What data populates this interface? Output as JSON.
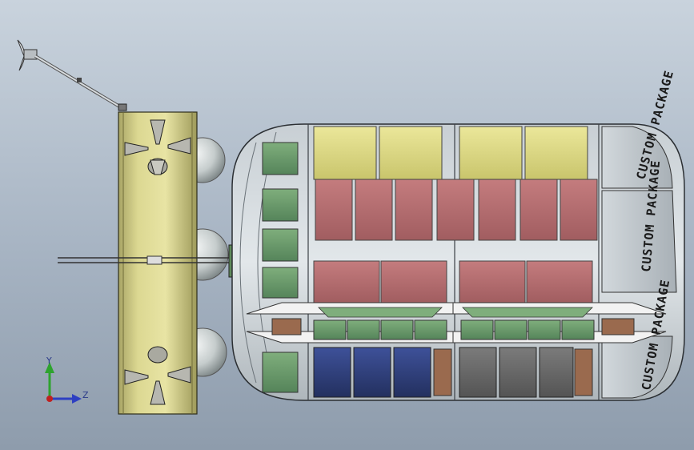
{
  "pod_labels": {
    "top": "CUSTOM PACKAGE",
    "middle": "CUSTOM PACKAGE",
    "bottom": "CUSTOM PACKAGE"
  },
  "triad": {
    "y_label": "Y",
    "z_label": "Z"
  },
  "colors": {
    "background_top": "#c9d3dd",
    "background_bottom": "#8e9cac",
    "ring_yellow": "#d8d48c",
    "tank_grey": "#cfd6d6",
    "rack_yellow": "#e0dc8a",
    "rack_red": "#b5696b",
    "rack_green": "#6c9a6a",
    "rack_blue": "#2f3f7a",
    "rack_grey": "#6a6a6a",
    "rack_brown": "#9a6a4e",
    "axis_y": "#2ea32e",
    "axis_z": "#2d3fc2",
    "axis_origin": "#c02020"
  }
}
